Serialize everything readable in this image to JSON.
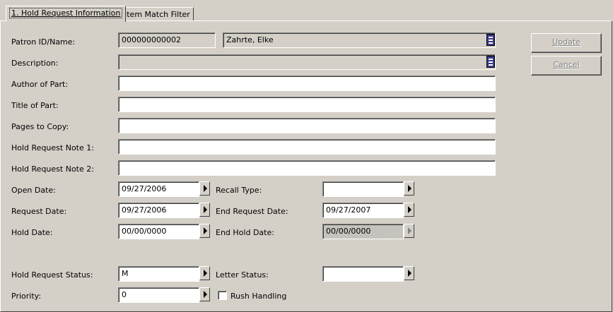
{
  "tabs": [
    {
      "label": "1. Hold Request Information"
    },
    {
      "label": "2. Item Match Filter"
    }
  ],
  "buttons": {
    "update": "Update",
    "cancel": "Cancel"
  },
  "labels": {
    "patron": "Patron ID/Name:",
    "description": "Description:",
    "author": "Author of Part:",
    "title": "Title of Part:",
    "pages": "Pages to Copy:",
    "note1": "Hold Request Note 1:",
    "note2": "Hold Request Note 2:",
    "open_date": "Open Date:",
    "recall_type": "Recall Type:",
    "request_date": "Request Date:",
    "end_request_date": "End Request Date:",
    "hold_date": "Hold Date:",
    "end_hold_date": "End Hold Date:",
    "status": "Hold Request Status:",
    "letter_status": "Letter Status:",
    "priority": "Priority:",
    "rush": "Rush Handling"
  },
  "values": {
    "patron_id": "000000000002",
    "patron_name": "Zahrte, Elke",
    "description": "",
    "author": "",
    "title": "",
    "pages": "",
    "note1": "",
    "note2": "",
    "open_date": "09/27/2006",
    "recall_type": "",
    "request_date": "09/27/2006",
    "end_request_date": "09/27/2007",
    "hold_date": "00/00/0000",
    "end_hold_date": "00/00/0000",
    "status": "M",
    "letter_status": "",
    "priority": "0",
    "rush_handling": false
  }
}
